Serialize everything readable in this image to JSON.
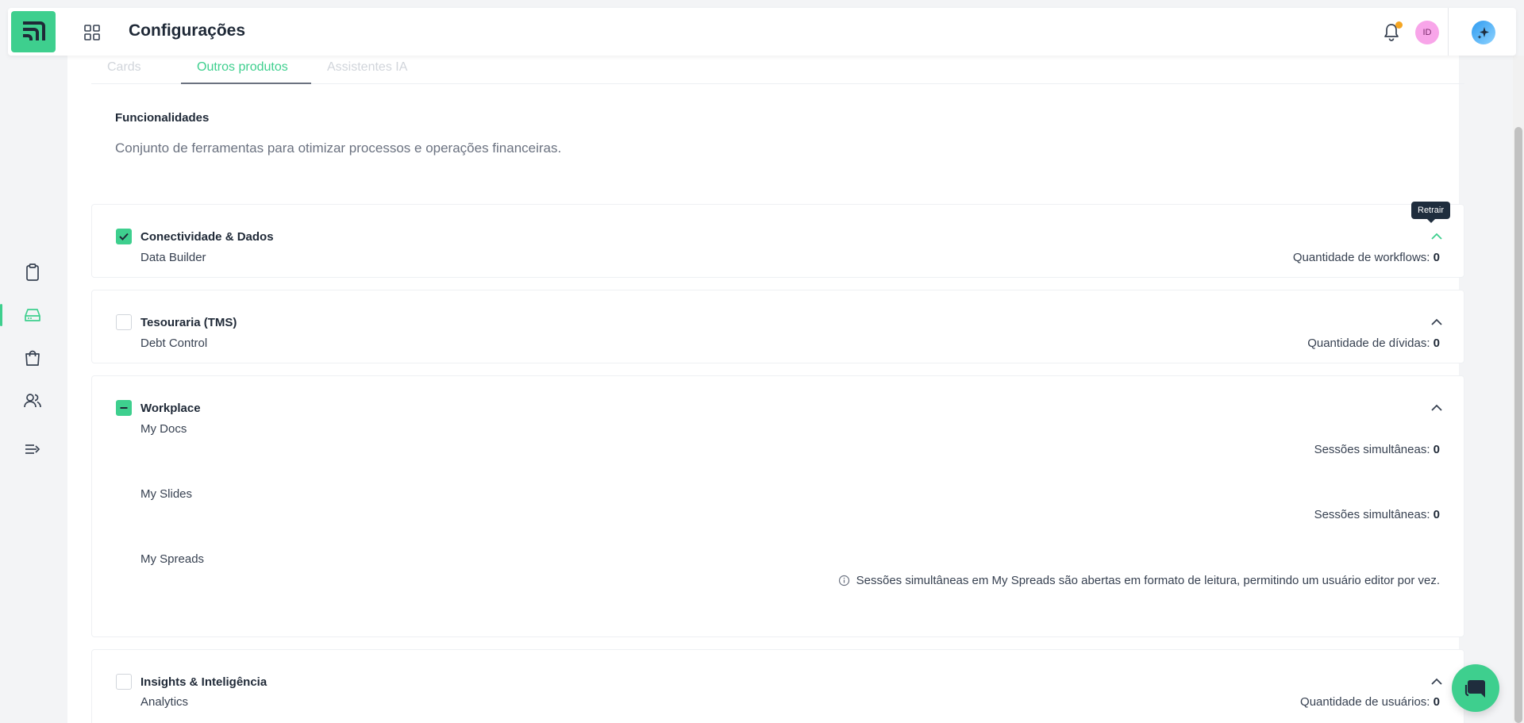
{
  "header": {
    "title": "Configurações",
    "avatar_initials": "ID"
  },
  "tabs": [
    {
      "label": "Cards",
      "active": false
    },
    {
      "label": "Outros produtos",
      "active": true
    },
    {
      "label": "Assistentes IA",
      "active": false
    }
  ],
  "section": {
    "title": "Funcionalidades",
    "description": "Conjunto de ferramentas para otimizar processos e operações financeiras."
  },
  "tooltip": "Retrair",
  "groups": [
    {
      "title": "Conectividade & Dados",
      "state": "checked",
      "items": [
        {
          "name": "Data Builder",
          "metric_label": "Quantidade de workflows:",
          "metric_value": "0"
        }
      ]
    },
    {
      "title": "Tesouraria (TMS)",
      "state": "unchecked",
      "items": [
        {
          "name": "Debt Control",
          "metric_label": "Quantidade de dívidas:",
          "metric_value": "0"
        }
      ]
    },
    {
      "title": "Workplace",
      "state": "partial",
      "items": [
        {
          "name": "My Docs",
          "metric_label": "Sessões simultâneas:",
          "metric_value": "0"
        },
        {
          "name": "My Slides",
          "metric_label": "Sessões simultâneas:",
          "metric_value": "0"
        },
        {
          "name": "My Spreads",
          "note": "Sessões simultâneas em My Spreads são abertas em formato de leitura, permitindo um usuário editor por vez."
        }
      ]
    },
    {
      "title": "Insights & Inteligência",
      "state": "unchecked",
      "items": [
        {
          "name": "Analytics",
          "metric_label": "Quantidade de usuários:",
          "metric_value": "0"
        }
      ]
    }
  ],
  "colors": {
    "accent": "#3ecf8e",
    "text": "#1f2937",
    "muted": "#6b7280",
    "tooltip_bg": "#1f2d3d",
    "notification_dot": "#f5a623"
  }
}
